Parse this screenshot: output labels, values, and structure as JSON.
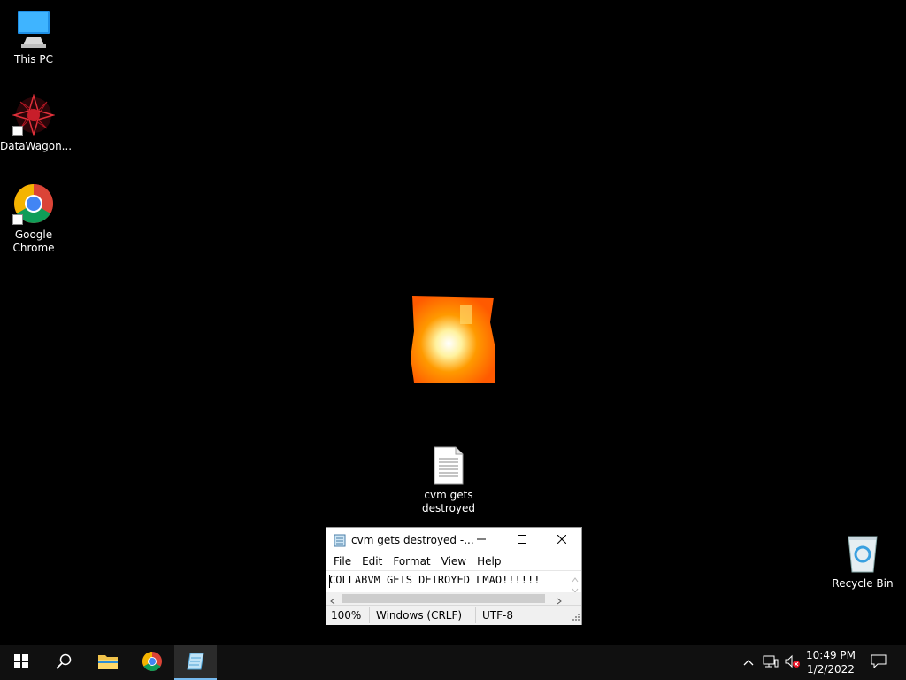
{
  "desktop": {
    "icons": [
      {
        "label": "This PC",
        "icon": "this-pc-icon"
      },
      {
        "label": "DataWagon...",
        "icon": "datawagon-icon"
      },
      {
        "label": "Google\nChrome",
        "icon": "chrome-icon"
      },
      {
        "label": "cvm gets\ndestroyed",
        "icon": "text-file-icon"
      },
      {
        "label": "Recycle Bin",
        "icon": "recycle-bin-icon"
      }
    ]
  },
  "notepad": {
    "title": "cvm gets destroyed -...",
    "menu": [
      "File",
      "Edit",
      "Format",
      "View",
      "Help"
    ],
    "content": "COLLABVM GETS DETROYED LMAO!!!!!!",
    "status": {
      "zoom": "100%",
      "line_ending": "Windows (CRLF)",
      "encoding": "UTF-8"
    }
  },
  "taskbar": {
    "apps": [
      "start",
      "search",
      "file-explorer",
      "chrome",
      "notepad"
    ],
    "active_app": "notepad",
    "clock": {
      "time": "10:49 PM",
      "date": "1/2/2022"
    }
  },
  "colors": {
    "desktop": "#000000",
    "taskbar": "#101010",
    "accent": "#76b9ed",
    "burn_orange": "#ff6a00"
  }
}
